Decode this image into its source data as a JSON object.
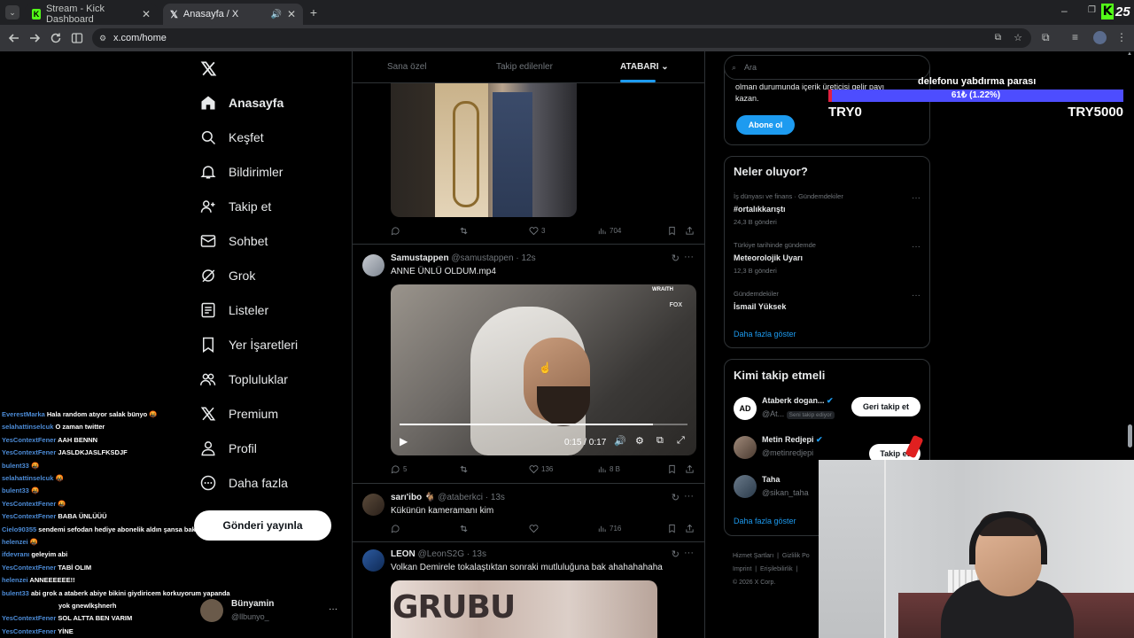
{
  "browser": {
    "tabs": [
      {
        "title": "Stream - Kick Dashboard"
      },
      {
        "title": "Anasayfa / X"
      }
    ],
    "url": "x.com/home"
  },
  "nav": {
    "items": [
      {
        "label": "Anasayfa",
        "icon": "home-icon"
      },
      {
        "label": "Keşfet",
        "icon": "search-icon"
      },
      {
        "label": "Bildirimler",
        "icon": "bell-icon"
      },
      {
        "label": "Takip et",
        "icon": "person-add-icon"
      },
      {
        "label": "Sohbet",
        "icon": "mail-icon"
      },
      {
        "label": "Grok",
        "icon": "grok-icon"
      },
      {
        "label": "Listeler",
        "icon": "list-icon"
      },
      {
        "label": "Yer İşaretleri",
        "icon": "bookmark-icon"
      },
      {
        "label": "Topluluklar",
        "icon": "communities-icon"
      },
      {
        "label": "Premium",
        "icon": "x-logo-icon"
      },
      {
        "label": "Profil",
        "icon": "profile-icon"
      },
      {
        "label": "Daha fazla",
        "icon": "more-circle-icon"
      }
    ],
    "post_button": "Gönderi yayınla",
    "account": {
      "name": "Bünyamin",
      "handle": "@llbunyo_",
      "more": "···"
    }
  },
  "feed": {
    "tabs": [
      "Sana özel",
      "Takip edilenler",
      "ATABARI"
    ],
    "posts": [
      {
        "replies": "",
        "reposts": "",
        "likes": "3",
        "views": "704"
      },
      {
        "name": "Samustappen",
        "handle": "@samustappen",
        "time": "12s",
        "text": "ANNE ÜNLÜ OLDUM.mp4",
        "video_time": "0:15 / 0:17",
        "video_progress": 0.88,
        "watermark": "WRAITH",
        "watermark2": "FOX",
        "replies": "5",
        "reposts": "",
        "likes": "136",
        "views": "8 B"
      },
      {
        "name": "sarı'ibo",
        "badge": "🐐",
        "handle": "@ataberkci",
        "time": "13s",
        "text": "Kükünün kameramanı kim",
        "replies": "",
        "reposts": "",
        "likes": "",
        "views": "716"
      },
      {
        "name": "LEON",
        "handle": "@LeonS2G",
        "time": "13s",
        "text": "Volkan Demirele tokalaştıktan sonraki mutluluğuna bak ahahahahaha",
        "image_text": "GRUBU"
      }
    ]
  },
  "sidebar": {
    "search_placeholder": "Ara",
    "premium": {
      "text1": "olman durumunda içerik üreticisi gelir payı",
      "text2": "kazan.",
      "button": "Abone ol"
    },
    "trends": {
      "title": "Neler oluyor?",
      "items": [
        {
          "meta": "İş dünyası ve finans · Gündemdekiler",
          "name": "#ortalıkkarıştı",
          "count": "24,3 B gönderi"
        },
        {
          "meta": "Türkiye tarihinde gündemde",
          "name": "Meteorolojik Uyarı",
          "count": "12,3 B gönderi"
        },
        {
          "meta": "Gündemdekiler",
          "name": "İsmail Yüksek",
          "count": ""
        }
      ],
      "more": "Daha fazla göster"
    },
    "who_to_follow": {
      "title": "Kimi takip etmeli",
      "items": [
        {
          "name": "Ataberk dogan...",
          "handle": "@At...",
          "follows_you": "Seni takip ediyor",
          "button": "Geri takip et"
        },
        {
          "name": "Metin Redjepi",
          "handle": "@metinredjepi",
          "button": "Takip et"
        },
        {
          "name": "Taha",
          "handle": "@sikan_taha",
          "button": ""
        }
      ],
      "more": "Daha fazla göster"
    },
    "footer": [
      "Hizmet Şartları",
      "Gizlilik Po",
      "Imprint",
      "Erişilebilirlik",
      "© 2026 X Corp."
    ]
  },
  "stream_goal": {
    "title": "delefonu yabdırma parası",
    "progress_text": "61₺ (1.22%)",
    "progress": 0.0122,
    "min": "TRY0",
    "max": "TRY5000"
  },
  "chat": [
    {
      "user": "EverestMarka",
      "text": "Hala random atıyor salak bünyo 🤬"
    },
    {
      "user": "selahattinselcuk",
      "text": "O zaman twitter"
    },
    {
      "user": "YesContextFener",
      "text": "AAH BENNN"
    },
    {
      "user": "YesContextFener",
      "text": "JASLDKJASLFKSDJF"
    },
    {
      "user": "bulent33",
      "text": "🤬"
    },
    {
      "user": "selahattinselcuk",
      "text": "🤬"
    },
    {
      "user": "bulent33",
      "text": "🤬"
    },
    {
      "user": "YesContextFener",
      "text": "🤬"
    },
    {
      "user": "YesContextFener",
      "text": "BABA ÜNLÜÜÜ"
    },
    {
      "user": "Cielo90355",
      "text": "sendemi sefodan hediye abonelik aldın şansa bak"
    },
    {
      "user": "helenzei",
      "text": "🤬"
    },
    {
      "user": "ifdevranı",
      "text": "geleyim abi"
    },
    {
      "user": "YesContextFener",
      "text": "TABİ OLIM"
    },
    {
      "user": "helenzei",
      "text": "ANNEEEEEE!!"
    },
    {
      "user": "bulent33",
      "text": "abi grok a ataberk abiye bikini giydiricem korkuyorum yapanda"
    },
    {
      "user": "",
      "text": "yok gnewlkşhnerh"
    },
    {
      "user": "YesContextFener",
      "text": "SOL ALTTA BEN VARIM"
    },
    {
      "user": "YesContextFener",
      "text": "YİNE"
    }
  ],
  "colors": {
    "accent": "#1d9bf0",
    "kick_green": "#53fc18",
    "goal_bar": "#4d4dff",
    "chat_user": "#4c8bd6"
  },
  "kick_logo": "K 25"
}
